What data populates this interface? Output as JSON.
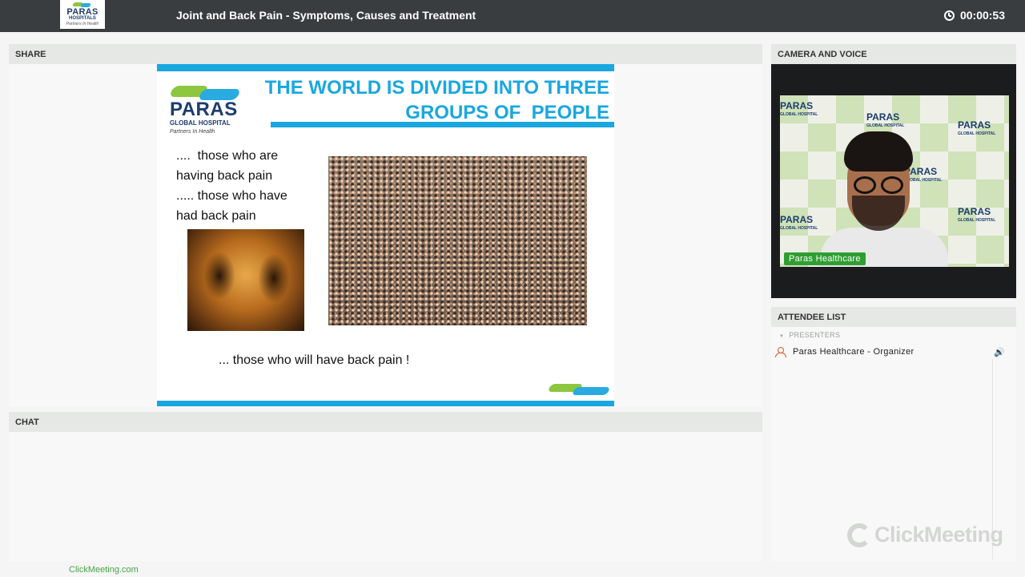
{
  "header": {
    "logo": {
      "line1": "PARAS",
      "line2": "HOSPITALS",
      "tagline": "Partners In Health"
    },
    "title": "Joint and Back Pain - Symptoms, Causes and Treatment",
    "timer": "00:00:53",
    "timer_icon": "clock-icon"
  },
  "share": {
    "label": "SHARE",
    "slide": {
      "logo": {
        "name": "PARAS",
        "sub": "GLOBAL HOSPITAL",
        "tagline": "Partners In Health"
      },
      "title_line1": "THE WORLD IS DIVIDED INTO THREE",
      "title_line2": "GROUPS OF  PEOPLE",
      "bullets": [
        "....  those who are",
        "having back pain",
        "..... those who have",
        "had back pain"
      ],
      "closing": "... those who will have back pain !"
    }
  },
  "chat": {
    "label": "CHAT"
  },
  "camera": {
    "label": "CAMERA AND VOICE",
    "name_tag": "Paras Healthcare",
    "backdrop": {
      "name": "PARAS",
      "sub": "GLOBAL HOSPITAL"
    }
  },
  "attendees": {
    "label": "ATTENDEE LIST",
    "group_label": "PRESENTERS",
    "items": [
      {
        "name": "Paras Healthcare - Organizer",
        "icon": "user-icon",
        "status_icon": "speaker-icon"
      }
    ]
  },
  "branding": {
    "watermark": "ClickMeeting",
    "footer_link": "ClickMeeting.com"
  },
  "colors": {
    "accent": "#19a7e0",
    "brand_green": "#8dc63f",
    "status_green": "#2f9e32",
    "topbar": "#3a3d3f"
  }
}
